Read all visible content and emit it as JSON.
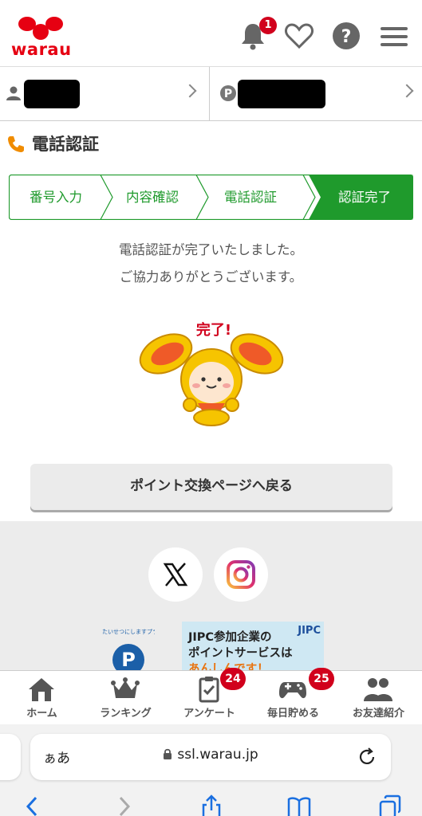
{
  "header": {
    "logo_text": "warau",
    "notification_count": "1",
    "icons": [
      "bell-icon",
      "heart-icon",
      "help-icon",
      "menu-icon"
    ]
  },
  "account": {
    "user_icon": "user-icon",
    "points_icon": "points-icon"
  },
  "page_title": "電話認証",
  "steps": [
    {
      "label": "番号入力",
      "active": false
    },
    {
      "label": "内容確認",
      "active": false
    },
    {
      "label": "電話認証",
      "active": false
    },
    {
      "label": "認証完了",
      "active": true
    }
  ],
  "message": {
    "line1": "電話認証が完了いたしました。",
    "line2": "ご協力ありがとうございます。"
  },
  "character": {
    "caption": "完了!"
  },
  "back_button": "ポイント交換ページへ戻る",
  "footer": {
    "social": [
      "x-icon",
      "instagram-icon"
    ],
    "privacy_mark_text": "たいせつにしますプライバシー",
    "jipc_banner": {
      "logo": "JIPC",
      "line1": "JIPC参加企業の",
      "line2": "ポイントサービスは",
      "line3": "あんしんです！"
    }
  },
  "tabbar": [
    {
      "label": "ホーム",
      "icon": "home-icon",
      "badge": ""
    },
    {
      "label": "ランキング",
      "icon": "crown-icon",
      "badge": ""
    },
    {
      "label": "アンケート",
      "icon": "survey-icon",
      "badge": "24"
    },
    {
      "label": "毎日貯める",
      "icon": "gamepad-icon",
      "badge": "25"
    },
    {
      "label": "お友達紹介",
      "icon": "friends-icon",
      "badge": ""
    }
  ],
  "browser": {
    "aa_label": "ぁあ",
    "url": "ssl.warau.jp"
  },
  "colors": {
    "brand_red": "#e60012",
    "step_green": "#1f9a2c",
    "badge_red": "#d1001c"
  }
}
